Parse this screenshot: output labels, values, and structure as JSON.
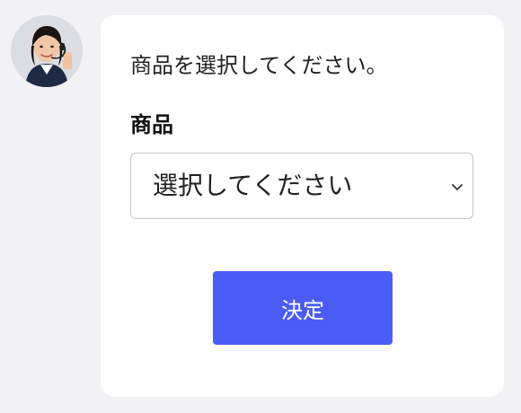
{
  "chat": {
    "avatar_icon": "agent-avatar-icon",
    "message": "商品を選択してください。"
  },
  "form": {
    "label": "商品",
    "select": {
      "selected_value": "選択してください",
      "icon": "chevron-down-icon"
    },
    "submit_label": "決定"
  },
  "colors": {
    "background": "#f2f2f5",
    "card": "#ffffff",
    "button": "#4b5cf5",
    "border": "#c7c7c7"
  }
}
